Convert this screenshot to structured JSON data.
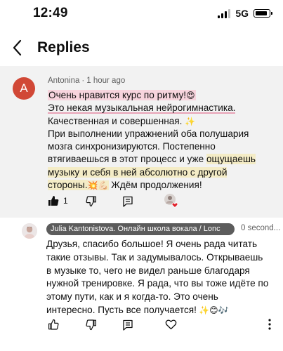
{
  "status_bar": {
    "time": "12:49",
    "network": "5G"
  },
  "header": {
    "title": "Replies"
  },
  "comment": {
    "avatar_letter": "A",
    "author": "Antonina",
    "time": "1 hour ago",
    "lines": {
      "l1": "Очень нравится курс по ритму!",
      "l1_emoji": "😍",
      "l2": "Это некая музыкальная нейрогимнастика.",
      "l3": "Качественная и совершенная.",
      "l3_emoji": "✨",
      "l4": "При выполнении упражнений оба полушария",
      "l5": "мозга синхронизируются. Постепенно",
      "l6a": "втягиваешься в этот процесс и уже ",
      "l6b": "ощущаешь",
      "l7": "музыку и себя в ней абсолютно с другой",
      "l8a": "стороны.",
      "l8_emoji": "💥💪🏻",
      "l8b": " Ждём продолжения!"
    },
    "like_count": "1"
  },
  "reply": {
    "author": "Julia Kantonistova. Онлайн школа вокала / Lonc",
    "time": "0 second...",
    "lines": {
      "l1": "Друзья, спасибо большое! Я очень рада читать",
      "l2": "такие отзывы. Так и задумывалось. Открываешь",
      "l3": "в музыке то, чего не видел раньше благодаря",
      "l4": "нужной тренировке. Я рада, что вы тоже идёте по",
      "l5": "этому пути, как и я когда-то. Это очень",
      "l6": "интересно. Пусть все получается!",
      "l6_emoji": " ✨😊🎶"
    }
  },
  "icons": [
    "back-chevron",
    "thumbs-up",
    "thumbs-down",
    "reply-bubble",
    "creator-heart",
    "more-vertical"
  ]
}
